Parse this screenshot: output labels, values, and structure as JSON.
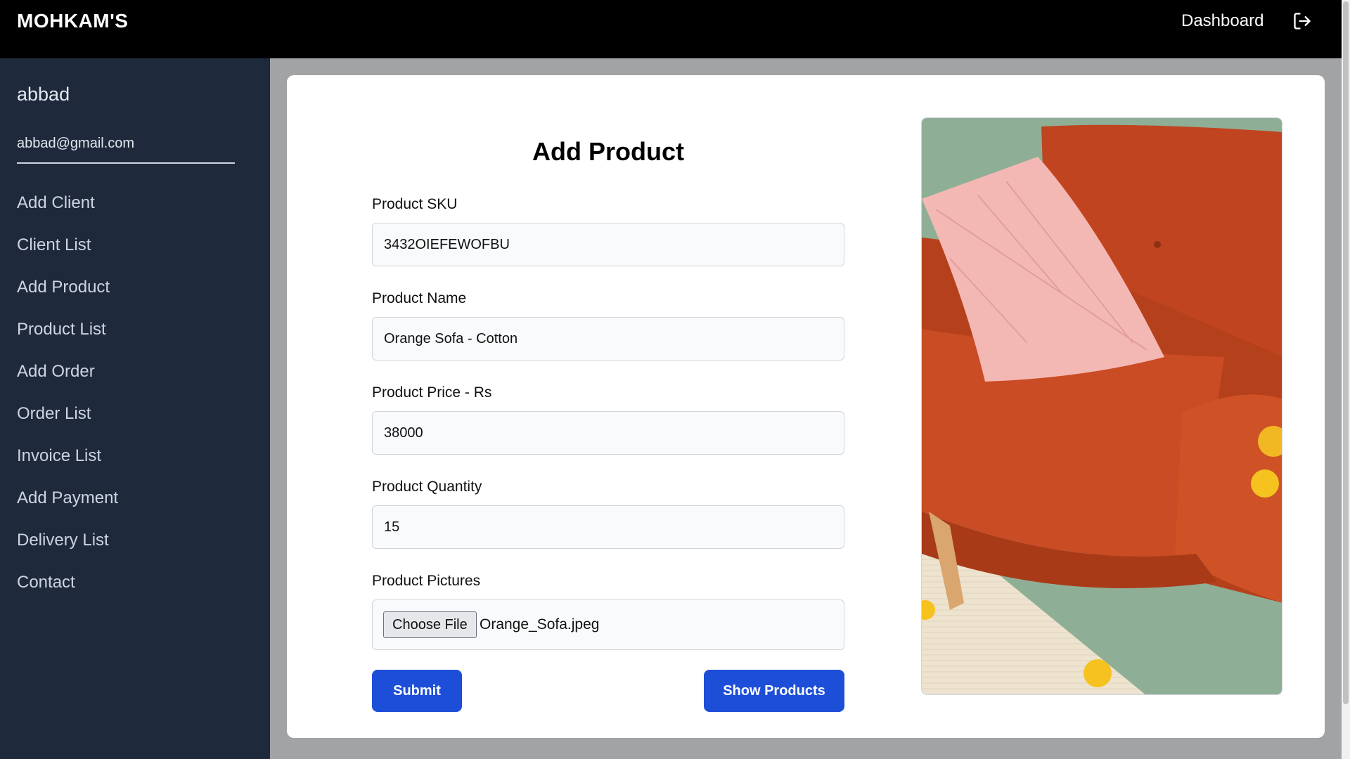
{
  "header": {
    "brand": "MOHKAM'S",
    "dashboard_link": "Dashboard",
    "logout_icon": "logout-icon"
  },
  "sidebar": {
    "user_name": "abbad",
    "user_email": "abbad@gmail.com",
    "items": [
      {
        "label": "Add Client"
      },
      {
        "label": "Client List"
      },
      {
        "label": "Add Product"
      },
      {
        "label": "Product List"
      },
      {
        "label": "Add Order"
      },
      {
        "label": "Order List"
      },
      {
        "label": "Invoice List"
      },
      {
        "label": "Add Payment"
      },
      {
        "label": "Delivery List"
      },
      {
        "label": "Contact"
      }
    ]
  },
  "form": {
    "title": "Add Product",
    "sku": {
      "label": "Product SKU",
      "value": "3432OIEFEWOFBU"
    },
    "name": {
      "label": "Product Name",
      "value": "Orange Sofa - Cotton"
    },
    "price": {
      "label": "Product Price - Rs",
      "value": "38000"
    },
    "quantity": {
      "label": "Product Quantity",
      "value": "15"
    },
    "pictures": {
      "label": "Product Pictures",
      "choose_label": "Choose File",
      "file_name": "Orange_Sofa.jpeg"
    },
    "submit_label": "Submit",
    "show_label": "Show Products"
  },
  "colors": {
    "topbar": "#000000",
    "sidebar": "#1e293b",
    "accent": "#1d4ed8"
  }
}
